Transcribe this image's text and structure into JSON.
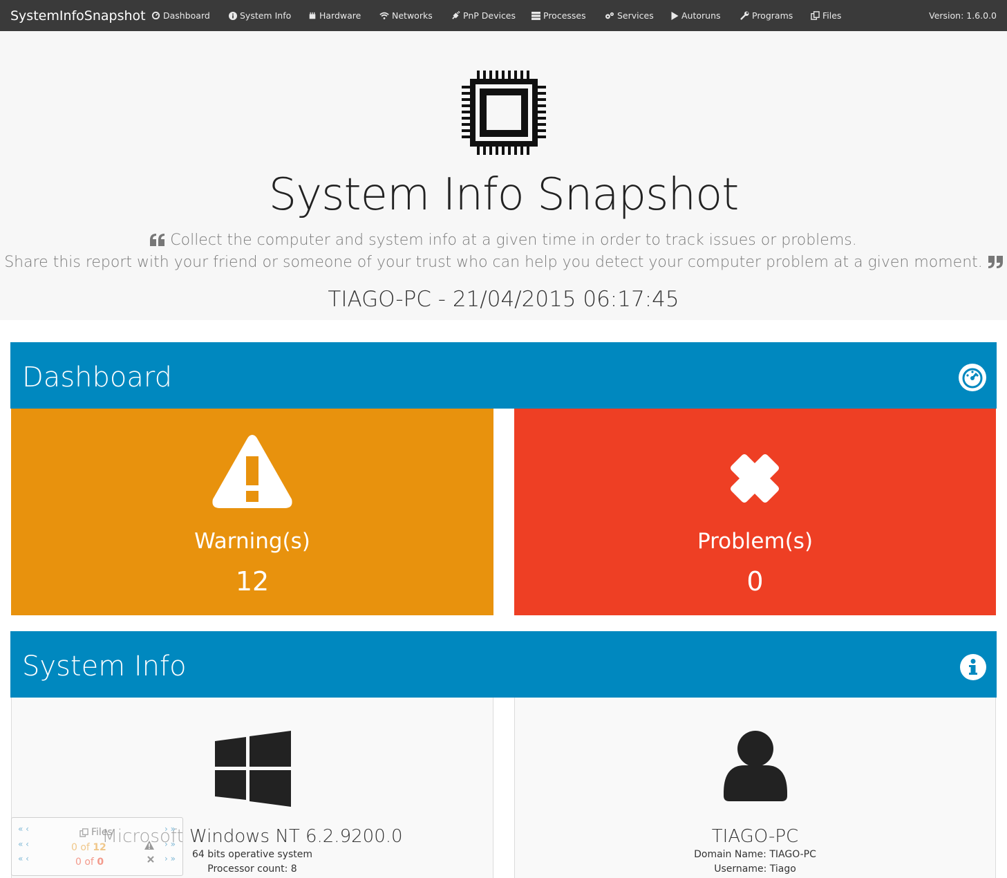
{
  "navbar": {
    "brand": "SystemInfoSnapshot",
    "items": [
      {
        "label": "Dashboard",
        "icon": "dashboard-icon"
      },
      {
        "label": "System Info",
        "icon": "info-icon"
      },
      {
        "label": "Hardware",
        "icon": "hardware-icon"
      },
      {
        "label": "Networks",
        "icon": "wifi-icon"
      },
      {
        "label": "PnP Devices",
        "icon": "plug-icon"
      },
      {
        "label": "Processes",
        "icon": "server-icon"
      },
      {
        "label": "Services",
        "icon": "cogs-icon"
      },
      {
        "label": "Autoruns",
        "icon": "play-icon"
      },
      {
        "label": "Programs",
        "icon": "wrench-icon"
      },
      {
        "label": "Files",
        "icon": "files-icon"
      }
    ],
    "version": "Version: 1.6.0.0"
  },
  "hero": {
    "title": "System Info Snapshot",
    "quote_line1": "Collect the computer and system info at a given time in order to track issues or problems.",
    "quote_line2": "Share this report with your friend or someone of your trust who can help you detect your computer problem at a given moment.",
    "machine": "TIAGO-PC - 21/04/2015 06:17:45"
  },
  "dashboard": {
    "title": "Dashboard",
    "warning_label": "Warning(s)",
    "warning_count": "12",
    "problem_label": "Problem(s)",
    "problem_count": "0"
  },
  "system_info": {
    "title": "System Info",
    "os_name": "Microsoft Windows NT 6.2.9200.0",
    "os_arch": "64 bits operative system",
    "processor_count": "Processor count: 8",
    "computer_name": "TIAGO-PC",
    "domain_name": "Domain Name: TIAGO-PC",
    "username": "Username: Tiago"
  },
  "mini_widget": {
    "section": "Files",
    "warnings_prefix": "0 of ",
    "warnings_total": "12",
    "problems_prefix": "0 of ",
    "problems_total": "0"
  },
  "colors": {
    "navbar": "#3a3a3a",
    "panel_header": "#0088bf",
    "warning": "#e8920d",
    "problem": "#ee3f24"
  }
}
